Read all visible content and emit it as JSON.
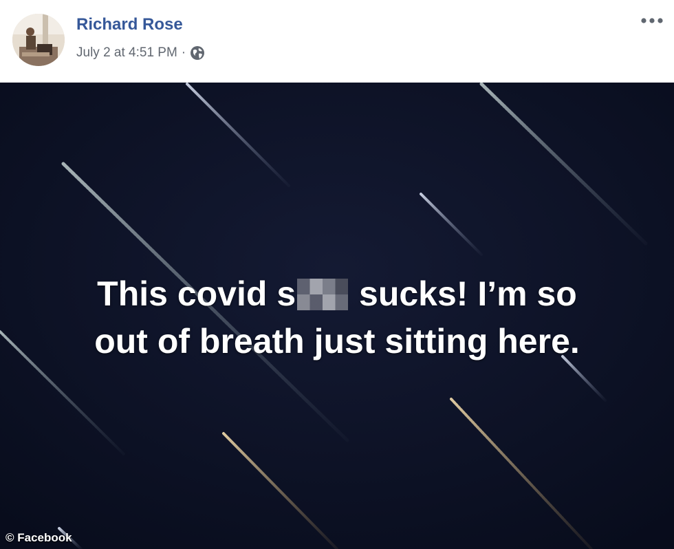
{
  "post": {
    "author": "Richard Rose",
    "timestamp": "July 2 at 4:51 PM",
    "separator": "·",
    "privacy_icon": "globe-icon",
    "more_icon": "more-options-icon",
    "text_line1_before": "This covid s",
    "text_line1_after": " sucks! I’m so",
    "text_line2": "out of breath just sitting here.",
    "background_color": "#0b1022"
  },
  "credit": "© Facebook",
  "colors": {
    "author_link": "#365899",
    "meta_text": "#616770",
    "post_text": "#ffffff"
  }
}
